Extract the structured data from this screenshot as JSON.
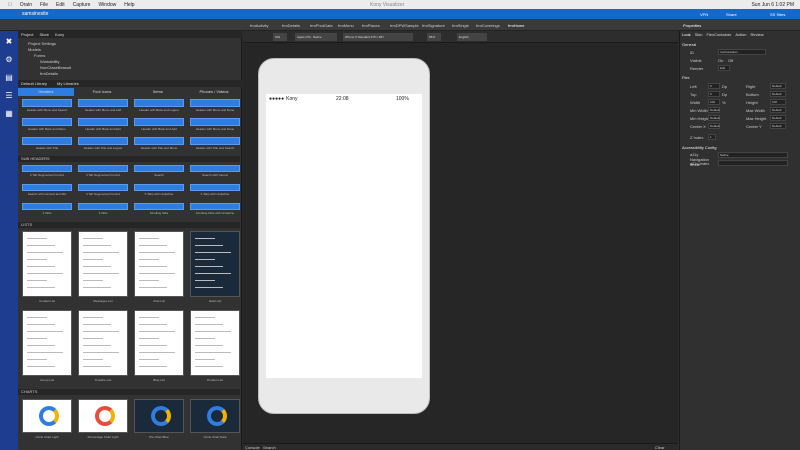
{
  "menubar": {
    "items": [
      "Orain",
      "File",
      "Edit",
      "Capture",
      "Window",
      "Help"
    ],
    "center": "Kony Visualizer",
    "clock": "Sun Jun 6  1:02 PM"
  },
  "titlebar": {
    "project": "samsinesite",
    "user": "SS Sites",
    "vpn": "VPN",
    "share": "Share"
  },
  "tabs": [
    "frmActivity",
    "frmDetails",
    "frmPhotGate",
    "frmMenu",
    "frmPlaces",
    "frmDPWSample",
    "frmSignature",
    "frmSingle",
    "frmCoverings",
    "frmHome"
  ],
  "left": {
    "project_tabs": [
      "Project",
      "Store",
      "Kony"
    ],
    "tree": [
      "Project Settings",
      "Models",
      "Forms",
      "Workability",
      "NonCtaseBeasuit",
      "frmDetails"
    ],
    "library_tabs": [
      "Default Library",
      "My Libraries"
    ],
    "segments": [
      "Headers",
      "Foot Icons",
      "Items",
      "Phones / Videos"
    ],
    "header_buttons": [
      "Header with Menu and Search",
      "Header with Menu and Add",
      "Header with Back and Logout",
      "Header with Menu and Done",
      "Header with Back and Menu",
      "Header with Back and Edit",
      "Header with Back and Add",
      "Header with Menu and Done",
      "Header with Title",
      "Header with Title and Logout",
      "Header with Title and Menu",
      "Header with Title and Search"
    ],
    "sub_headers": "SUB HEADERS",
    "sub_header_caps": [
      "2 Tab Segmented Control",
      "3 Tab Segmented Control",
      "Search",
      "Search with Cancel",
      "Search with Camera and Mic",
      "3 Tab Segmented Control",
      "3 Tabs with Underline",
      "4 Tabs with Underline",
      "2 Tabs",
      "3 Tabs",
      "Scrolling Tabs",
      "Scrolling Tabs with Underline"
    ],
    "lists": "LISTS",
    "list_caps": [
      "Contact List",
      "Messages List",
      "Chat List",
      "Hotel List",
      "Group List",
      "Timeline List",
      "Blog List",
      "Product List"
    ],
    "charts": "CHARTS",
    "chart_caps": [
      "Circle Chart Light",
      "Percentage Chart Light",
      "Pie Chart Blue",
      "Circle Chart Dark"
    ]
  },
  "canvas": {
    "toolbar": [
      "IOS",
      "Apple iOS : Native",
      "iPhone 6 Standard 375 x 667",
      "65%",
      "English"
    ],
    "status": {
      "carrier": "Kony",
      "time": "22:08",
      "battery": "100%"
    }
  },
  "right": {
    "title": "Properties",
    "tabs": [
      "Look",
      "Skin",
      "FlexContainer",
      "Action",
      "Review"
    ],
    "general": "General",
    "id_label": "ID",
    "id_value": "rowContainer",
    "visible_label": "Visible",
    "visible_on": "On",
    "visible_off": "Off",
    "render": "Render",
    "edit": "Edit",
    "flex": "Flex",
    "rows": [
      [
        "Left",
        "0",
        "Dp",
        "Right",
        "Default"
      ],
      [
        "Top",
        "0",
        "Dp",
        "Bottom",
        "Default"
      ],
      [
        "Width",
        "100",
        "%",
        "Height",
        "100"
      ],
      [
        "Min Width",
        "Default",
        "",
        "Max Width",
        "Default"
      ],
      [
        "Min Height",
        "Default",
        "",
        "Max Height",
        "Default"
      ],
      [
        "Center X",
        "Default",
        "",
        "Center Y",
        "Default"
      ]
    ],
    "zindex": "Z Index",
    "zvalue": "1",
    "acc": "Accessibility Config",
    "acc_rows": [
      "a11y Navigation Mode",
      "a11y Index"
    ],
    "acc_value": "Native"
  },
  "bottom": {
    "items": [
      "Console",
      "Search"
    ],
    "clear": "Clear"
  },
  "colors": {
    "accent": "#2f7de1",
    "rail": "#1e3d8f",
    "titlebar": "#1769c7"
  }
}
